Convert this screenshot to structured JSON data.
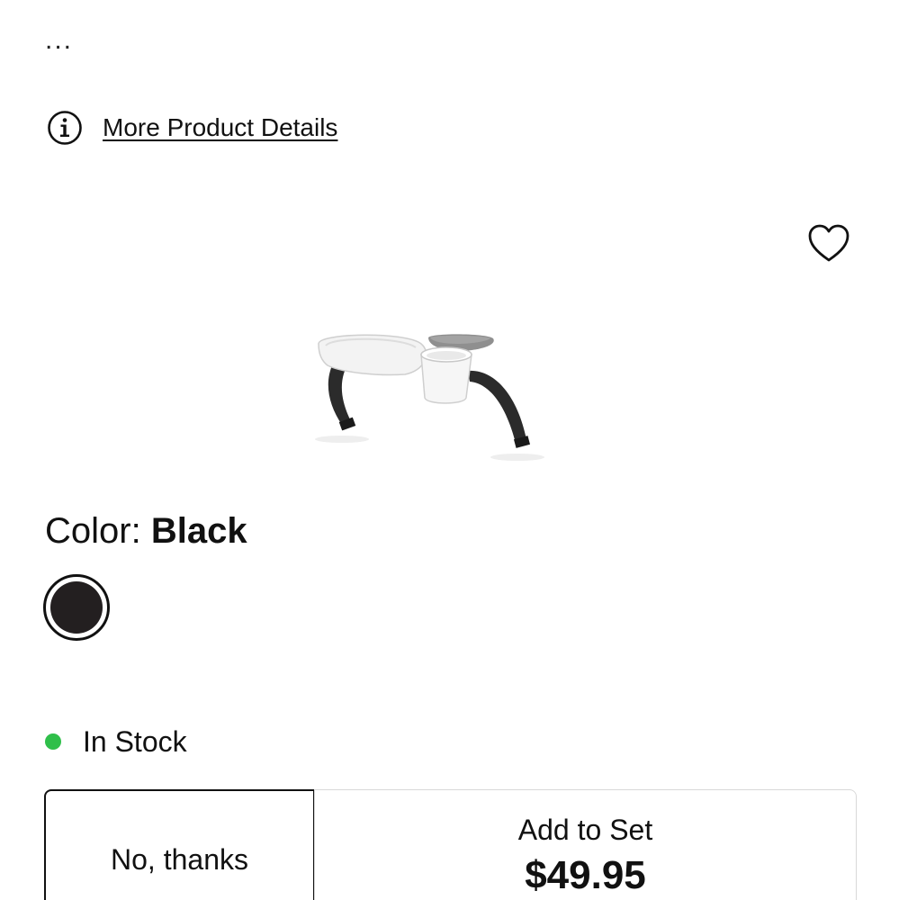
{
  "product": {
    "description_tail": "...",
    "details_link": "More Product Details",
    "image_alt": "Snack tray with cup holder",
    "color_label": "Color:",
    "color_value": "Black",
    "swatch_color": "#231f20",
    "stock_status": "In Stock",
    "stock_color": "#2fbf4a"
  },
  "actions": {
    "decline_label": "No, thanks",
    "add_label": "Add to Set",
    "add_price": "$49.95"
  },
  "icons": {
    "info": "info-icon",
    "favorite": "heart-icon"
  }
}
